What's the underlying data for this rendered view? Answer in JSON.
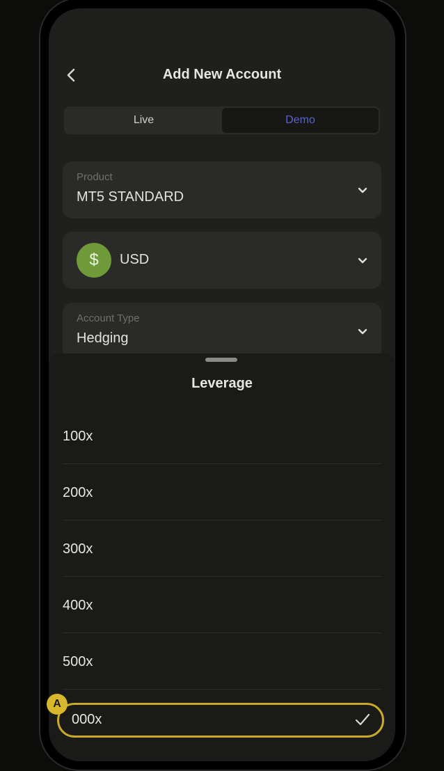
{
  "header": {
    "title": "Add New Account"
  },
  "tabs": [
    {
      "label": "Live"
    },
    {
      "label": "Demo"
    }
  ],
  "product": {
    "label": "Product",
    "value": "MT5 STANDARD"
  },
  "currency": {
    "symbol": "$",
    "value": "USD"
  },
  "account_type": {
    "label": "Account Type",
    "value": "Hedging"
  },
  "sheet": {
    "title": "Leverage",
    "options": [
      "100x",
      "200x",
      "300x",
      "400x",
      "500x",
      "000x"
    ]
  },
  "annotation": {
    "marker": "A"
  },
  "colors": {
    "accent": "#5b63c9",
    "highlight": "#c8a92a",
    "coin": "#6f9a3a"
  }
}
